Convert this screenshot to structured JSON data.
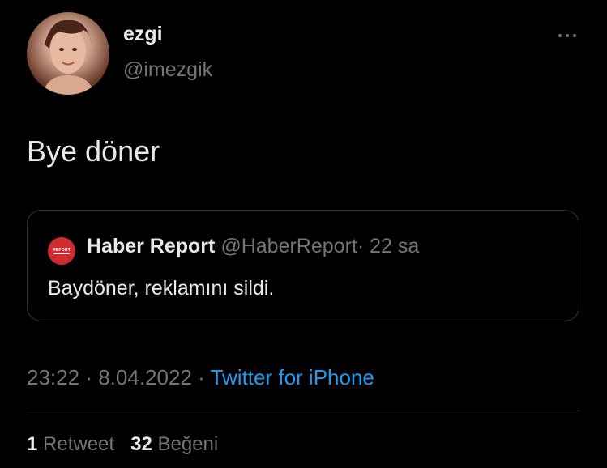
{
  "author": {
    "display_name": "ezgi",
    "handle": "@imezgik",
    "avatar_icon": "profile-photo"
  },
  "tweet": {
    "text": "Bye döner"
  },
  "quoted": {
    "logo_text": "REPORT",
    "name": "Haber Report",
    "handle": "@HaberReport",
    "separator": "·",
    "time": "22 sa",
    "text": "Baydöner, reklamını sildi."
  },
  "meta": {
    "time": "23:22",
    "sep1": "·",
    "date": "8.04.2022",
    "sep2": "·",
    "source": "Twitter for iPhone"
  },
  "stats": {
    "retweets": "1",
    "retweets_label": "Retweet",
    "likes": "32",
    "likes_label": "Beğeni"
  },
  "colors": {
    "background": "#000000",
    "text": "#e7e9ea",
    "muted": "#71767b",
    "link": "#1d9bf0",
    "border": "#2f3336",
    "logo": "#d02c2f"
  }
}
